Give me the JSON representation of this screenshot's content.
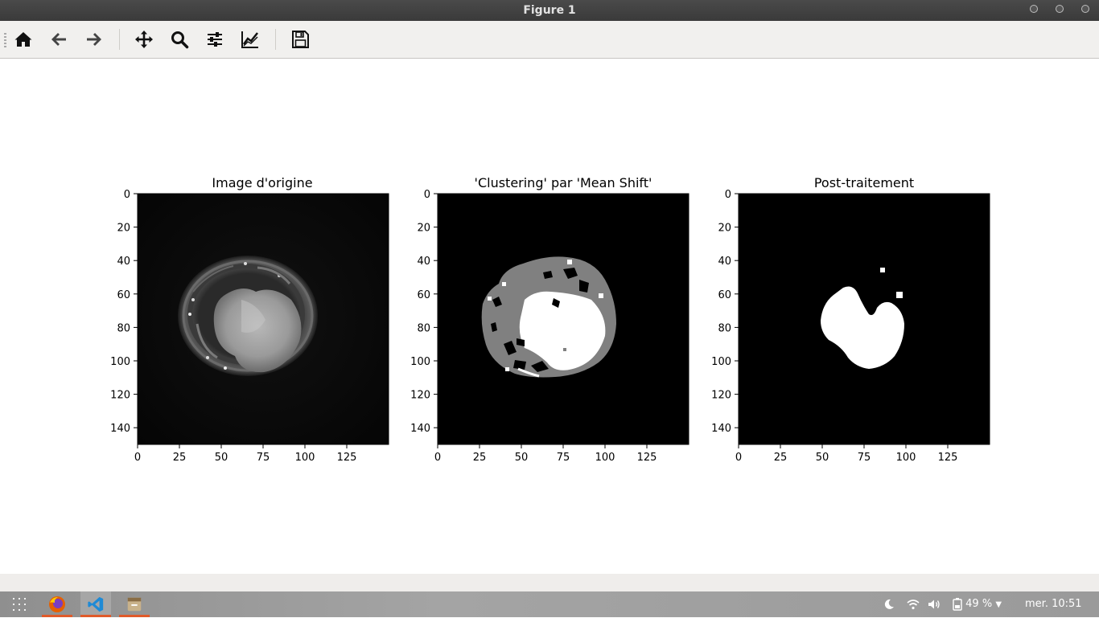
{
  "window": {
    "title": "Figure 1"
  },
  "toolbar": {
    "buttons": [
      {
        "name": "home-button",
        "icon": "home-icon"
      },
      {
        "name": "back-button",
        "icon": "arrow-left-icon"
      },
      {
        "name": "forward-button",
        "icon": "arrow-right-icon"
      },
      {
        "name": "pan-button",
        "icon": "move-icon"
      },
      {
        "name": "zoom-button",
        "icon": "magnifier-icon"
      },
      {
        "name": "subplots-button",
        "icon": "sliders-icon"
      },
      {
        "name": "edit-axis-button",
        "icon": "line-chart-icon"
      },
      {
        "name": "save-button",
        "icon": "floppy-icon"
      }
    ]
  },
  "chart_data": [
    {
      "type": "heatmap",
      "title": "Image d'origine",
      "xlim": [
        0,
        150
      ],
      "ylim": [
        150,
        0
      ],
      "xticks": [
        "0",
        "25",
        "50",
        "75",
        "100",
        "125"
      ],
      "yticks": [
        "0",
        "20",
        "40",
        "60",
        "80",
        "100",
        "120",
        "140"
      ],
      "colormap": "gray",
      "description_values": {
        "shape_center": [
          70,
          78
        ],
        "radius": [
          82,
          68
        ]
      }
    },
    {
      "type": "heatmap",
      "title": "'Clustering' par 'Mean Shift'",
      "xlim": [
        0,
        150
      ],
      "ylim": [
        150,
        0
      ],
      "xticks": [
        "0",
        "25",
        "50",
        "75",
        "100",
        "125"
      ],
      "yticks": [
        "0",
        "20",
        "40",
        "60",
        "80",
        "100",
        "120",
        "140"
      ],
      "colormap": "gray"
    },
    {
      "type": "heatmap",
      "title": "Post-traitement",
      "xlim": [
        0,
        150
      ],
      "ylim": [
        150,
        0
      ],
      "xticks": [
        "0",
        "25",
        "50",
        "75",
        "100",
        "125"
      ],
      "yticks": [
        "0",
        "20",
        "40",
        "60",
        "80",
        "100",
        "120",
        "140"
      ],
      "colormap": "gray"
    }
  ],
  "taskbar": {
    "apps": [
      {
        "name": "firefox",
        "icon": "firefox-icon"
      },
      {
        "name": "vscode",
        "icon": "vscode-icon"
      },
      {
        "name": "files",
        "icon": "archive-icon"
      }
    ],
    "battery": "49 %",
    "clock": "mer. 10:51"
  },
  "colors": {
    "accent": "#e05a2a",
    "titlebar": "#3f3f3f",
    "toolbar": "#f1f0ee"
  }
}
